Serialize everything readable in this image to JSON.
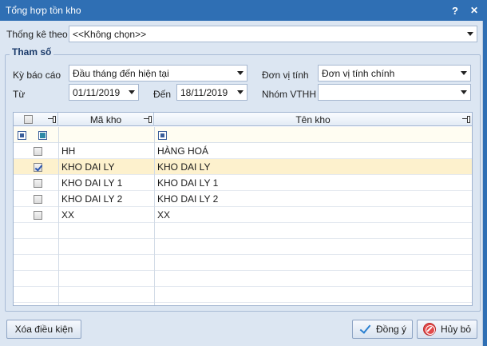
{
  "window": {
    "title": "Tổng hợp tồn kho",
    "help_glyph": "?",
    "close_glyph": "✕"
  },
  "filter": {
    "label": "Thống kê theo",
    "value": "<<Không chọn>>"
  },
  "group": {
    "title": "Tham số",
    "period_label": "Kỳ báo cáo",
    "period_value": "Đầu tháng đến hiện tại",
    "unit_label": "Đơn vị tính",
    "unit_value": "Đơn vị tính chính",
    "from_label": "Từ",
    "from_value": "01/11/2019",
    "to_label": "Đến",
    "to_value": "18/11/2019",
    "group_label": "Nhóm VTHH",
    "group_value": ""
  },
  "grid": {
    "columns": [
      "Mã kho",
      "Tên kho"
    ],
    "rows": [
      {
        "code": "HH",
        "name": "HÀNG HOÁ",
        "checked": false,
        "selected": false
      },
      {
        "code": "KHO DAI LY",
        "name": "KHO DAI LY",
        "checked": true,
        "selected": true
      },
      {
        "code": "KHO DAI LY 1",
        "name": "KHO DAI LY 1",
        "checked": false,
        "selected": false
      },
      {
        "code": "KHO DAI LY 2",
        "name": "KHO DAI LY 2",
        "checked": false,
        "selected": false
      },
      {
        "code": "XX",
        "name": "XX",
        "checked": false,
        "selected": false
      }
    ]
  },
  "buttons": {
    "clear": "Xóa điều kiện",
    "ok": "Đồng ý",
    "cancel": "Hủy bỏ"
  },
  "colors": {
    "titlebar": "#2f6fb4",
    "background": "#dce6f2",
    "selected_row": "#fdf1cd"
  }
}
